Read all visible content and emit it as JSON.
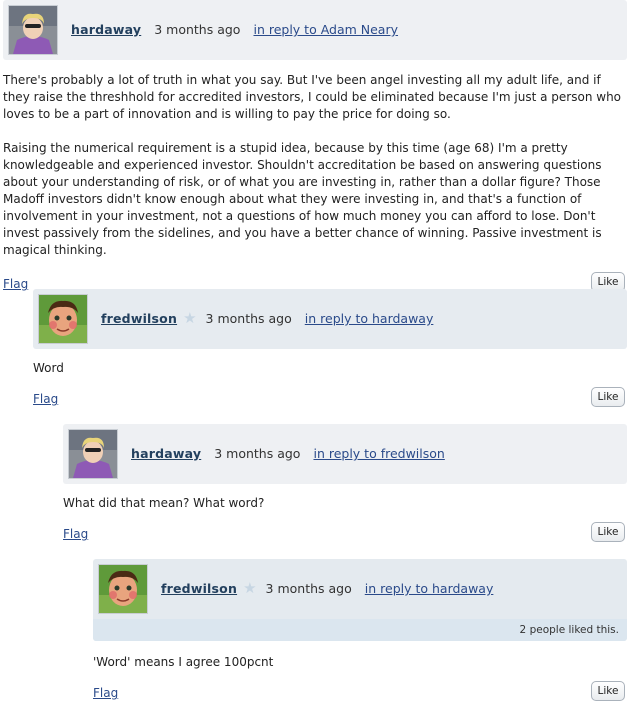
{
  "comments": [
    {
      "author": "hardaway",
      "time": "3 months ago",
      "reply_to": "in reply to Adam Neary",
      "body": [
        "There's probably a lot of truth in what you say. But I've been angel investing all my adult life, and if they raise the threshhold for accredited investors, I could be eliminated because I'm just a person who loves to be a part of innovation and is willing to pay the price for doing so.",
        "Raising the numerical requirement is a stupid idea, because by this time (age 68) I'm a pretty knowledgeable and experienced investor. Shouldn't accreditation be based on answering questions about your understanding of risk, or of what you are investing in, rather than a dollar figure? Those Madoff investors didn't know enough about what they were investing in, and that's a function of involvement in your investment, not a questions of how much money you can afford to lose. Don't invest passively from the sidelines, and you have a better chance of winning. Passive investment is magical thinking."
      ],
      "flag": "Flag",
      "like": "Like"
    },
    {
      "author": "fredwilson",
      "time": "3 months ago",
      "reply_to": "in reply to hardaway",
      "body": [
        "Word"
      ],
      "flag": "Flag",
      "like": "Like"
    },
    {
      "author": "hardaway",
      "time": "3 months ago",
      "reply_to": "in reply to fredwilson",
      "body": [
        "What did that mean? What word?"
      ],
      "flag": "Flag",
      "like": "Like"
    },
    {
      "author": "fredwilson",
      "time": "3 months ago",
      "reply_to": "in reply to hardaway",
      "likes_text": "2 people liked this.",
      "body": [
        "'Word' means I agree 100pcnt"
      ],
      "flag": "Flag",
      "like": "Like"
    }
  ],
  "colors": {
    "header_bg": "#eef0f3",
    "likes_bar_bg": "#dbe6ef",
    "link": "#2a4a8a",
    "author": "#23405e"
  },
  "icons": {
    "moderator_badge": "star-icon"
  }
}
